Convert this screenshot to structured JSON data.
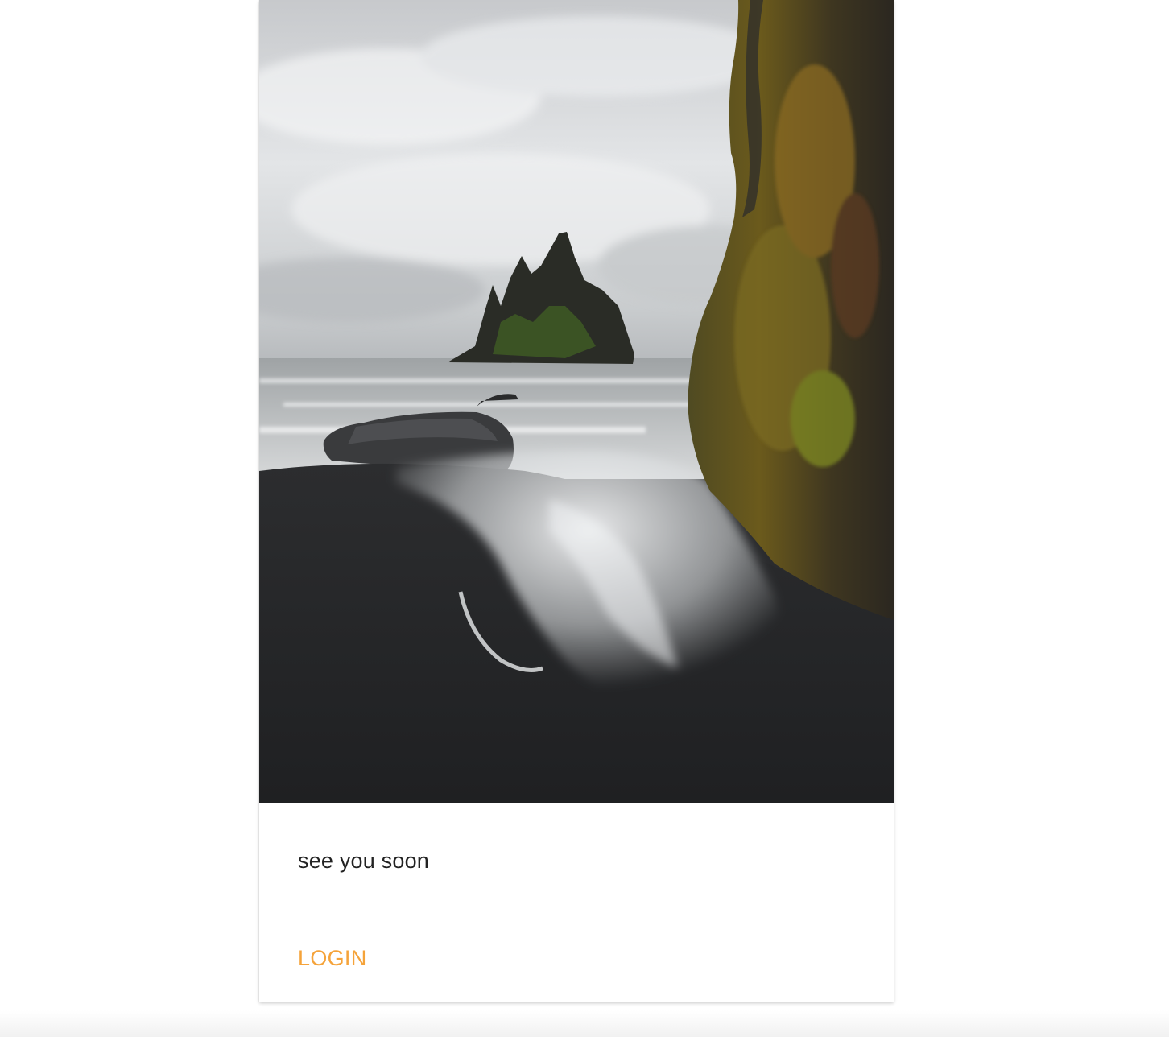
{
  "card": {
    "image": {
      "description": "",
      "icon": "photo"
    },
    "text": "see you soon",
    "action": {
      "label": "LOGIN",
      "color": "#f5a33a"
    }
  },
  "colors": {
    "page_background": "#ffffff",
    "card_background": "#ffffff",
    "text": "#222222",
    "divider": "#e3e3e3",
    "accent": "#f5a33a"
  }
}
